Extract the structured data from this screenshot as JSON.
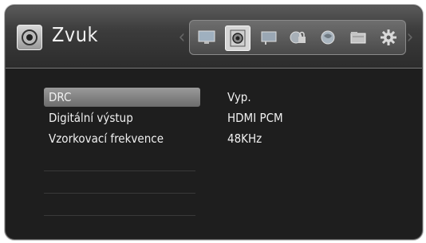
{
  "header": {
    "title": "Zvuk",
    "title_icon": "speaker-icon",
    "categories": [
      {
        "icon": "display-icon",
        "selected": false
      },
      {
        "icon": "audio-icon",
        "selected": true
      },
      {
        "icon": "language-icon",
        "selected": false
      },
      {
        "icon": "lock-icon",
        "selected": false
      },
      {
        "icon": "network-icon",
        "selected": false
      },
      {
        "icon": "folder-icon",
        "selected": false
      },
      {
        "icon": "gear-icon",
        "selected": false
      }
    ]
  },
  "settings": [
    {
      "label": "DRC",
      "value": "Vyp.",
      "selected": true
    },
    {
      "label": "Digitální výstup",
      "value": "HDMI PCM",
      "selected": false
    },
    {
      "label": "Vzorkovací frekvence",
      "value": "48KHz",
      "selected": false
    }
  ],
  "colors": {
    "background": "#1e1e1e",
    "highlight": "#8a8a8a",
    "text": "#f0f0f0"
  }
}
